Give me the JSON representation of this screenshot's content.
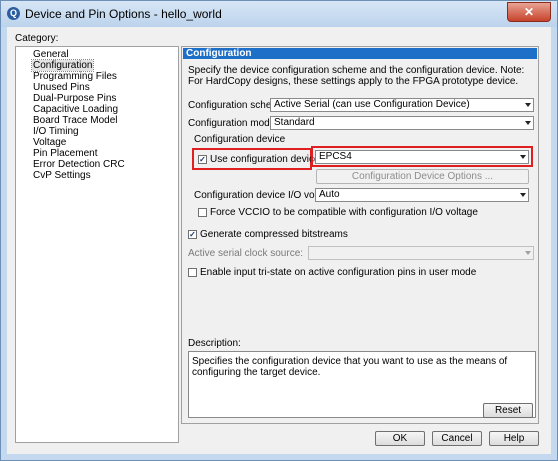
{
  "window": {
    "title": "Device and Pin Options - hello_world",
    "close_glyph": "✕",
    "app_icon_glyph": "Q"
  },
  "category": {
    "label": "Category:",
    "items": [
      "General",
      "Configuration",
      "Programming Files",
      "Unused Pins",
      "Dual-Purpose Pins",
      "Capacitive Loading",
      "Board Trace Model",
      "I/O Timing",
      "Voltage",
      "Pin Placement",
      "Error Detection CRC",
      "CvP Settings"
    ],
    "selected": "Configuration"
  },
  "panel": {
    "title": "Configuration",
    "description": "Specify the device configuration scheme and the configuration device. Note: For HardCopy designs, these settings apply to the FPGA prototype device.",
    "scheme_label": "Configuration scheme:",
    "scheme_value": "Active Serial (can use Configuration Device)",
    "mode_label": "Configuration mode:",
    "mode_value": "Standard",
    "config_device_group": "Configuration device",
    "use_config_device_label": "Use configuration device:",
    "use_config_device_checked": true,
    "config_device_value": "EPCS4",
    "config_device_options_button": "Configuration Device Options ...",
    "io_voltage_label": "Configuration device I/O voltage:",
    "io_voltage_value": "Auto",
    "force_vccio_label": "Force VCCIO to be compatible with configuration I/O voltage",
    "force_vccio_checked": false,
    "compressed_label": "Generate compressed bitstreams",
    "compressed_checked": true,
    "clock_source_label": "Active serial clock source:",
    "clock_source_value": "",
    "tristate_label": "Enable input tri-state on active configuration pins in user mode",
    "tristate_checked": false,
    "description_label": "Description:",
    "description_text": "Specifies the configuration device that you want to use as the means of configuring the target device.",
    "reset_button": "Reset",
    "check_glyph": "✓"
  },
  "footer": {
    "ok_button": "OK",
    "cancel_button": "Cancel",
    "help_button": "Help"
  },
  "colors": {
    "header_blue": "#1e6fc8",
    "highlight_red": "#e02020"
  }
}
